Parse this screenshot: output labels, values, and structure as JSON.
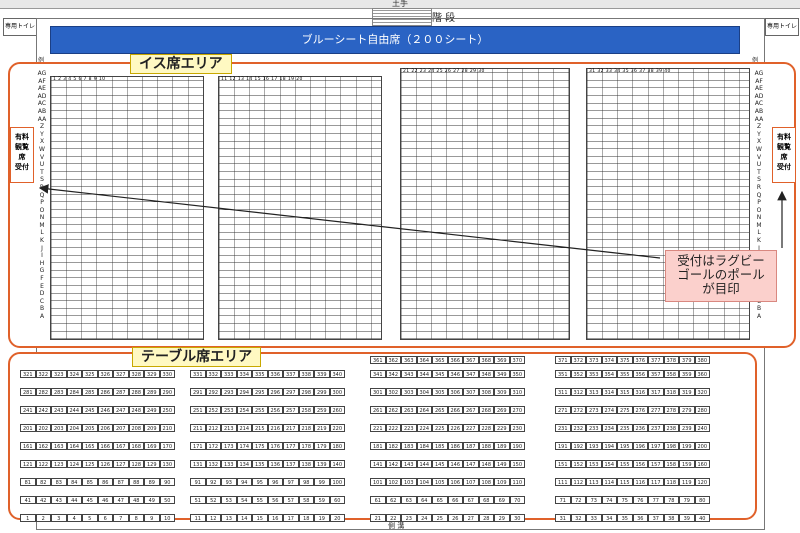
{
  "header": {
    "embankment": "土手",
    "stairs": "階 段",
    "toilet_left": "専用トイレ",
    "toilet_right": "専用トイレ"
  },
  "blue_sheet": "ブルーシート自由席（２００シート）",
  "side_marks": {
    "left": "例",
    "right": "例"
  },
  "chair_area": {
    "label": "イス席エリア",
    "rows": [
      "AG",
      "AF",
      "AE",
      "AD",
      "AC",
      "AB",
      "AA",
      "Z",
      "Y",
      "X",
      "W",
      "V",
      "U",
      "T",
      "S",
      "R",
      "Q",
      "P",
      "O",
      "N",
      "M",
      "L",
      "K",
      "J",
      "I",
      "H",
      "G",
      "F",
      "E",
      "D",
      "C",
      "B",
      "A"
    ],
    "blocks": [
      "1 2 3 4 5 6 7 8 9 10",
      "11 12 13 14 15 16 17 18 19 20",
      "21 22 23 24 25 26 27 28 29 30",
      "31 32 33 34 35 36 37 38 39 40"
    ]
  },
  "reception": {
    "left": [
      "有料",
      "観覧",
      "席",
      "受付"
    ],
    "right": [
      "有料",
      "観覧",
      "席",
      "受付"
    ]
  },
  "callout": [
    "受付はラグビー",
    "ゴールのポール",
    "が目印"
  ],
  "table_area": {
    "label": "テーブル席エリア",
    "rows": [
      [
        "321",
        "331",
        "341",
        "351"
      ],
      [
        "281",
        "291",
        "301",
        "311"
      ],
      [
        "241",
        "251",
        "261",
        "271"
      ],
      [
        "201",
        "211",
        "221",
        "231"
      ],
      [
        "161",
        "171",
        "181",
        "191"
      ],
      [
        "121",
        "131",
        "141",
        "151"
      ],
      [
        "81",
        "91",
        "101",
        "111"
      ],
      [
        "41",
        "51",
        "61",
        "71"
      ],
      [
        "1",
        "11",
        "21",
        "31"
      ]
    ],
    "top_row": [
      "361",
      "371"
    ]
  },
  "footer": "側 溝"
}
